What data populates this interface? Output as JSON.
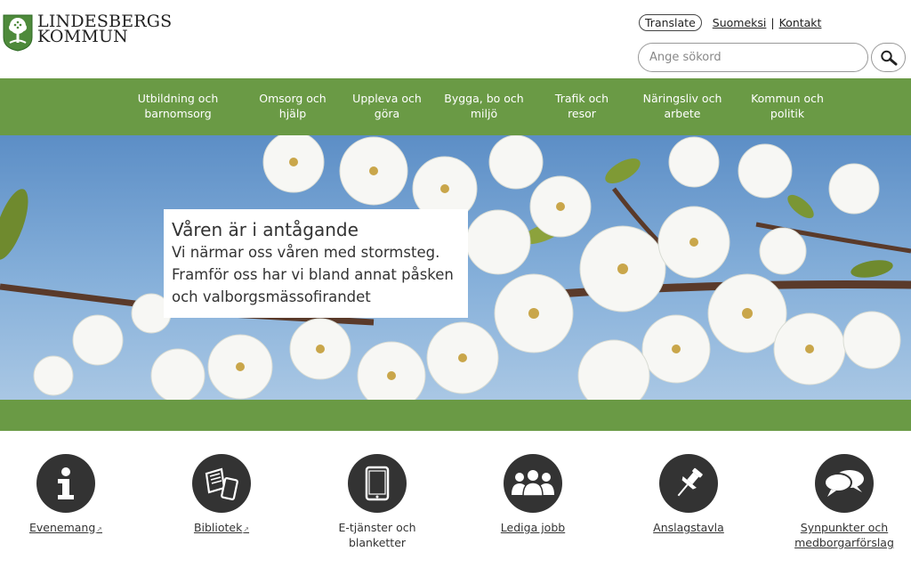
{
  "header": {
    "logo_line1": "LINDESBERGS",
    "logo_line2": "KOMMUN",
    "translate_label": "Translate",
    "link_suomeksi": "Suomeksi",
    "separator": "|",
    "link_kontakt": "Kontakt",
    "search_placeholder": "Ange sökord"
  },
  "nav": {
    "items": [
      {
        "line1": "Utbildning och",
        "line2": "barnomsorg"
      },
      {
        "line1": "Omsorg och",
        "line2": "hjälp"
      },
      {
        "line1": "Uppleva och",
        "line2": "göra"
      },
      {
        "line1": "Bygga, bo och",
        "line2": "miljö"
      },
      {
        "line1": "Trafik och",
        "line2": "resor"
      },
      {
        "line1": "Näringsliv och",
        "line2": "arbete"
      },
      {
        "line1": "Kommun och",
        "line2": "politik"
      }
    ]
  },
  "hero": {
    "title": "Våren är i antågande",
    "text_line1": "Vi närmar oss våren med stormsteg.",
    "text_line2": "Framför oss har vi bland annat påsken",
    "text_line3": "och valborgsmässofirandet"
  },
  "services": [
    {
      "line1": "Evenemang",
      "line2": "",
      "icon": "info-icon",
      "external": true
    },
    {
      "line1": "Bibliotek",
      "line2": "",
      "icon": "books-icon",
      "external": true
    },
    {
      "line1": "E-tjänster och",
      "line2": "blanketter",
      "icon": "tablet-icon",
      "external": false
    },
    {
      "line1": "Lediga jobb",
      "line2": "",
      "icon": "people-icon",
      "external": false
    },
    {
      "line1": "Anslagstavla",
      "line2": "",
      "icon": "pin-icon",
      "external": false
    },
    {
      "line1": "Synpunkter och",
      "line2": "medborgarförslag",
      "icon": "speech-bubbles-icon",
      "external": false
    }
  ],
  "colors": {
    "nav_green": "#6a9a45",
    "icon_dark": "#333333",
    "sky_blue": "#5c8ec6"
  },
  "external_marker": "↗"
}
